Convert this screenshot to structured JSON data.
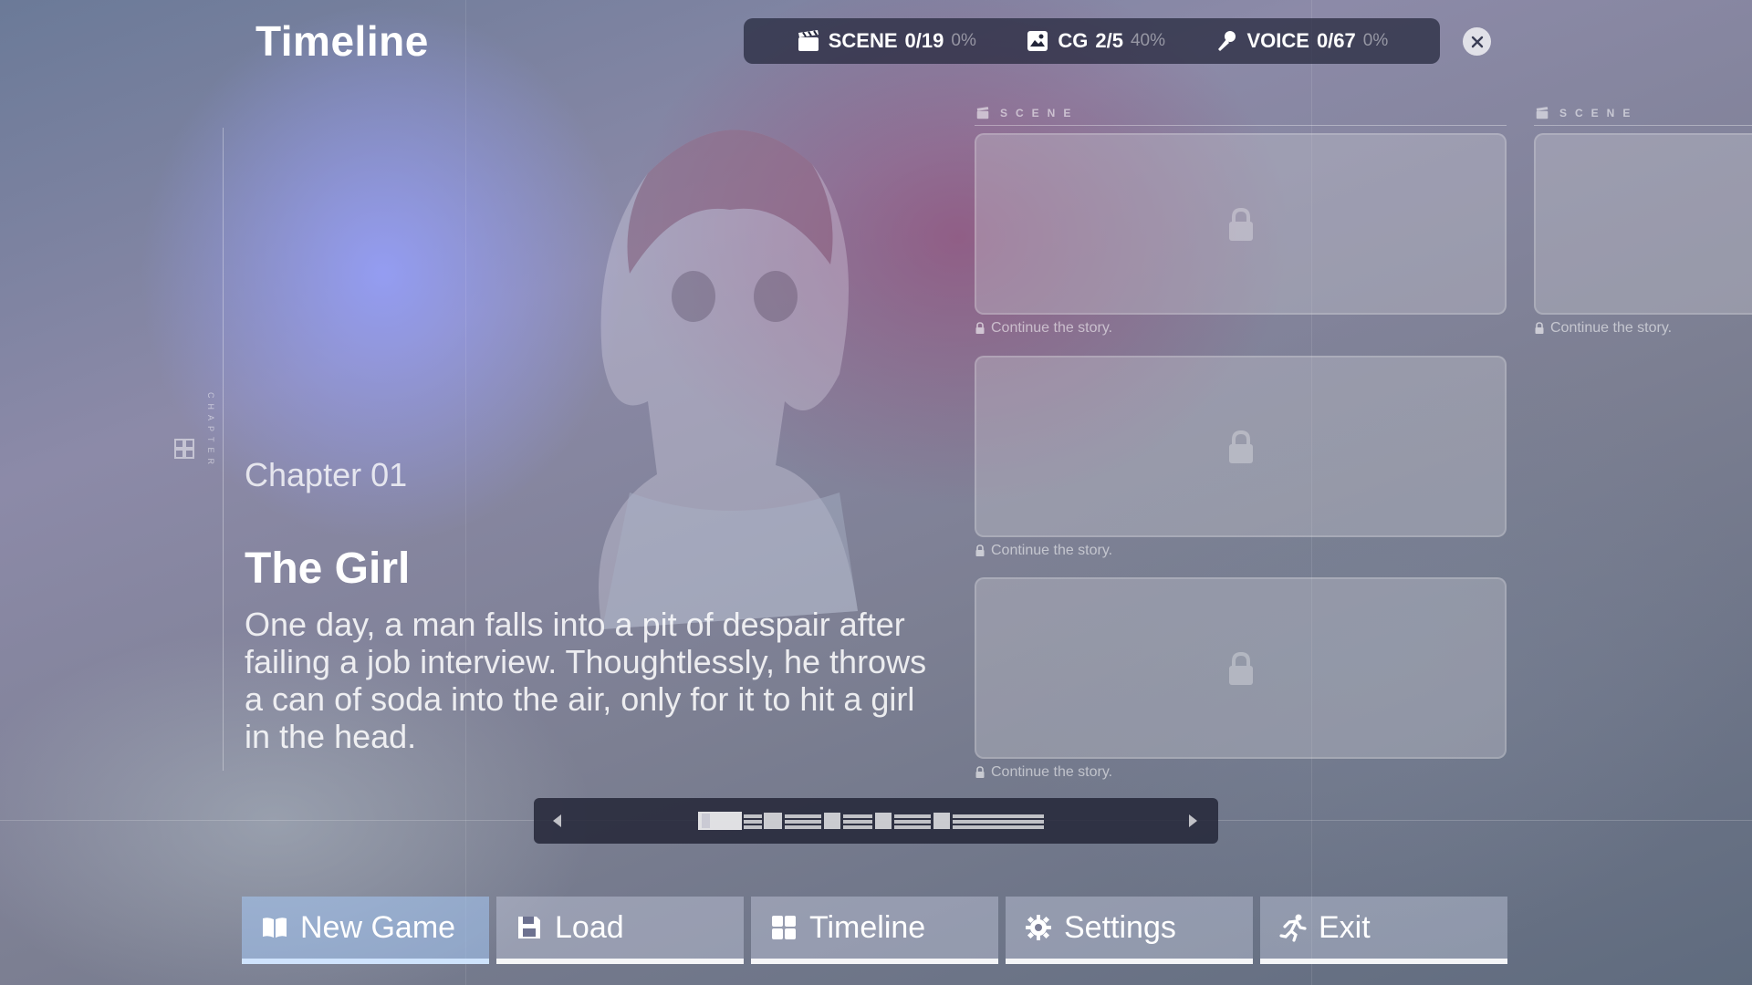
{
  "header": {
    "title": "Timeline",
    "stats": [
      {
        "icon": "clapperboard-icon",
        "label": "SCENE",
        "count": "0/19",
        "percent": "0%"
      },
      {
        "icon": "image-icon",
        "label": "CG",
        "count": "2/5",
        "percent": "40%"
      },
      {
        "icon": "microphone-icon",
        "label": "VOICE",
        "count": "0/67",
        "percent": "0%"
      }
    ],
    "close_icon": "close-icon"
  },
  "chapter": {
    "side_label": "CHAPTER",
    "number": "Chapter 01",
    "title": "The Girl",
    "description": "One day, a man falls into a pit of despair after failing a job interview. Thoughtlessly, he throws a can of soda into the air, only for it to hit a girl in the head."
  },
  "scene_columns": [
    {
      "label": "SCENE",
      "cards": [
        {
          "locked": true,
          "caption": "Continue the story."
        },
        {
          "locked": true,
          "caption": "Continue the story."
        },
        {
          "locked": true,
          "caption": "Continue the story."
        }
      ]
    },
    {
      "label": "SCENE",
      "cards": [
        {
          "locked": true,
          "caption": "Continue the story."
        }
      ]
    }
  ],
  "pager": {
    "prev_icon": "caret-left-icon",
    "next_icon": "caret-right-icon"
  },
  "menu": [
    {
      "label": "New Game",
      "icon": "book-icon",
      "active": true
    },
    {
      "label": "Load",
      "icon": "floppy-disk-icon",
      "active": false
    },
    {
      "label": "Timeline",
      "icon": "grid-icon",
      "active": false
    },
    {
      "label": "Settings",
      "icon": "gear-icon",
      "active": false
    },
    {
      "label": "Exit",
      "icon": "running-person-icon",
      "active": false
    }
  ],
  "colors": {
    "panel": "#23263a",
    "active_button": "#a5c8f5"
  }
}
